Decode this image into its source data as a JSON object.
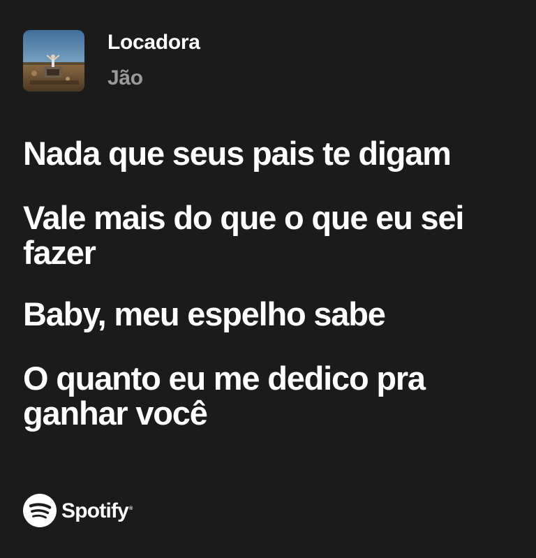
{
  "track": {
    "title": "Locadora",
    "artist": "Jão",
    "cover_icon": "album-cover-image"
  },
  "lyrics": [
    "Nada que seus pais te digam",
    "Vale mais do que o que eu sei fazer",
    "Baby, meu espelho sabe",
    "O quanto eu me dedico pra ganhar você"
  ],
  "brand": {
    "name": "Spotify",
    "trademark": "®",
    "icon": "spotify-logo-icon"
  },
  "colors": {
    "background": "#1b1b1b",
    "text_primary": "#ffffff",
    "text_secondary": "#9a9a9a"
  }
}
